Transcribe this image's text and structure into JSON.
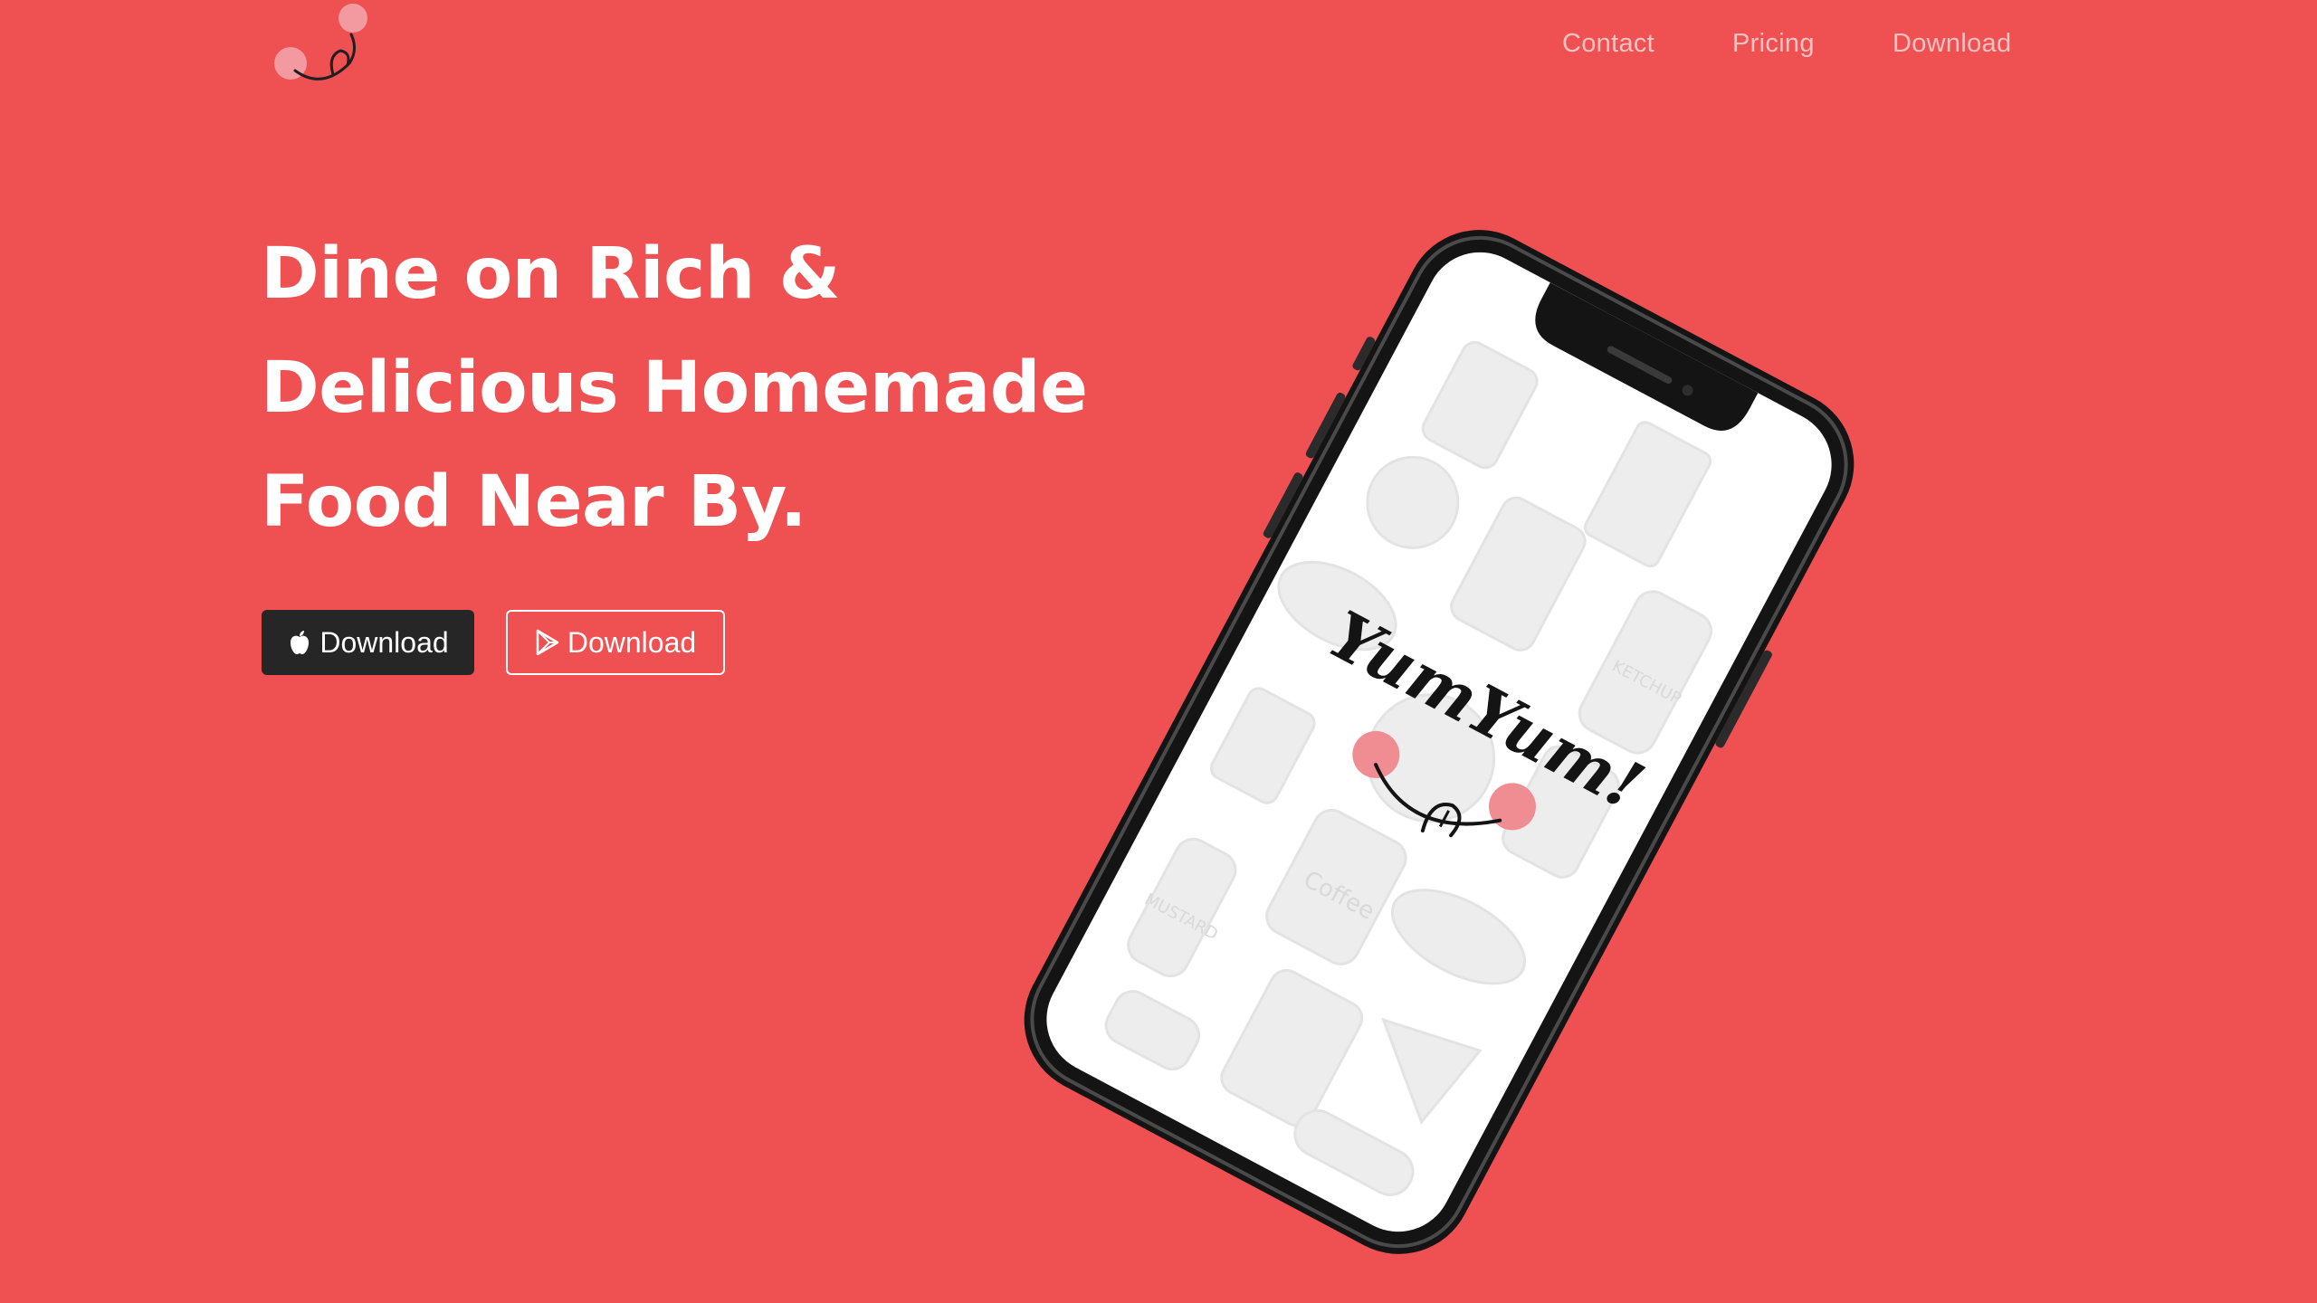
{
  "nav": {
    "items": [
      {
        "label": "Contact"
      },
      {
        "label": "Pricing"
      },
      {
        "label": "Download"
      }
    ]
  },
  "hero": {
    "title_lines": [
      "Dine on Rich &",
      "Delicious Homemade",
      "Food Near By."
    ]
  },
  "buttons": {
    "apple_label": "Download",
    "play_label": "Download"
  },
  "phone": {
    "logo_text": "YumYum!",
    "doodle_coffee": "Coffee",
    "doodle_mustard": "MUSTARD",
    "doodle_ketchup": "KETCHUP"
  },
  "colors": {
    "background": "#ef5052",
    "nav_text": "#f6c2c2",
    "apple_button": "#262626",
    "blush": "#ef8d93"
  },
  "icons": {
    "logo": "smiley-tongue-logo",
    "apple": "apple-icon",
    "play": "play-store-icon"
  }
}
